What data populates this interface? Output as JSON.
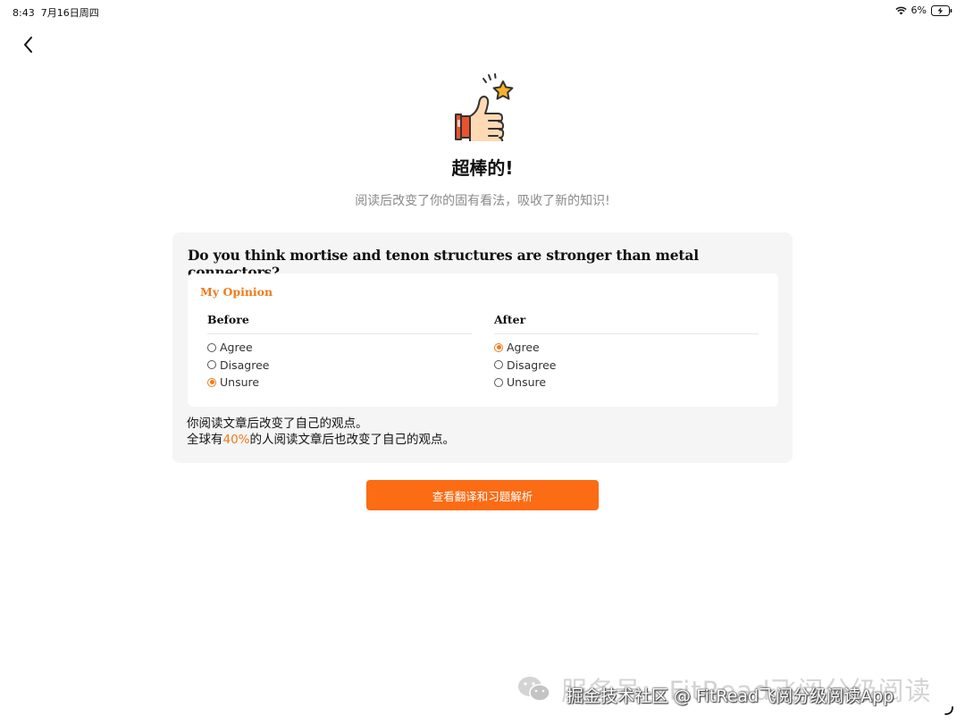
{
  "status_bar": {
    "time": "8:43",
    "date": "7月16日周四",
    "battery": "6%"
  },
  "hero": {
    "title": "超棒的!",
    "subtitle": "阅读后改变了你的固有看法，吸收了新的知识!"
  },
  "card": {
    "question": "Do you think mortise and tenon structures are stronger than metal connectors?",
    "opinion_label": "My Opinion",
    "before": {
      "title": "Before",
      "options": [
        "Agree",
        "Disagree",
        "Unsure"
      ],
      "selected": 2
    },
    "after": {
      "title": "After",
      "options": [
        "Agree",
        "Disagree",
        "Unsure"
      ],
      "selected": 0
    },
    "stat_line1": "你阅读文章后改变了自己的观点。",
    "stat_line2_prefix": "全球有",
    "stat_percent": "40%",
    "stat_line2_suffix": "的人阅读文章后也改变了自己的观点。"
  },
  "cta_label": "查看翻译和习题解析",
  "watermark": {
    "back_text": "服务号 · FitRead飞阅分级阅读",
    "front_text": "掘金技术社区 @ FitRead飞阅分级阅读App"
  },
  "colors": {
    "accent": "#f07a1a",
    "button": "#fb6c14",
    "card_bg": "#f5f5f5"
  }
}
